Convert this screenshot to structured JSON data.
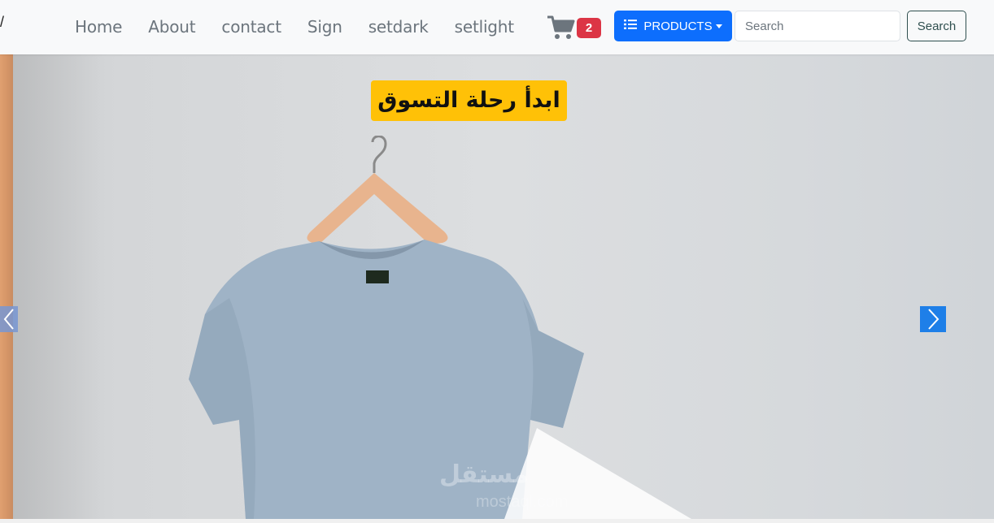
{
  "navbar": {
    "brand_fragment": "/",
    "links": [
      {
        "label": "Home"
      },
      {
        "label": "About"
      },
      {
        "label": "contact"
      },
      {
        "label": "Sign"
      },
      {
        "label": "setdark"
      },
      {
        "label": "setlight"
      }
    ],
    "cart": {
      "icon": "shopping-cart-icon",
      "count": "2"
    },
    "products_button": {
      "label": "PRODUCTS",
      "icon": "list-icon"
    },
    "search": {
      "placeholder": "Search",
      "value": "",
      "button_label": "Search"
    }
  },
  "carousel": {
    "headline": "ابدأ رحلة التسوق",
    "prev_icon": "chevron-left-icon",
    "next_icon": "chevron-right-icon",
    "watermark": "مستقل",
    "watermark_sub": "mostaql.com"
  },
  "colors": {
    "primary": "#0d6efd",
    "badge": "#dc3545",
    "headline_bg": "#ffc107",
    "nav_text": "#6c757d"
  }
}
